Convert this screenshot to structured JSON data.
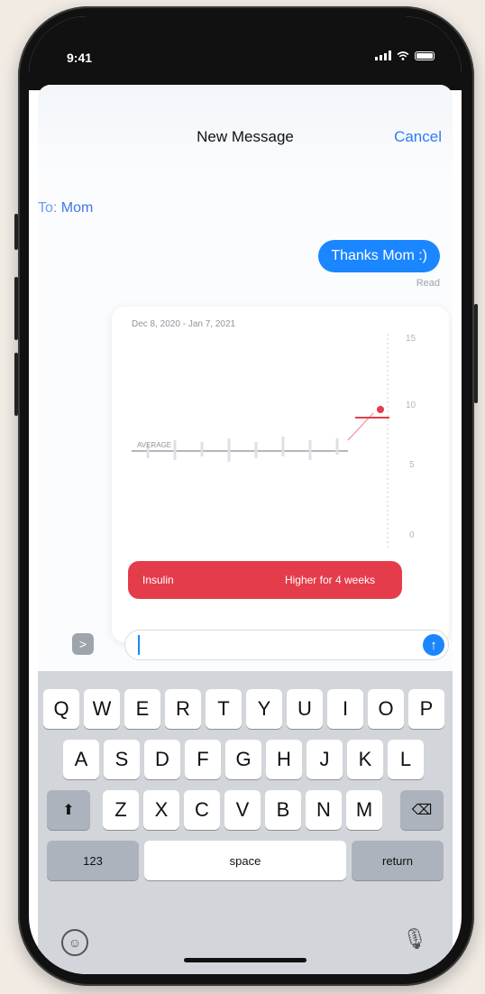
{
  "status": {
    "time": "9:41"
  },
  "nav": {
    "title": "New Message",
    "cancel_label": "Cancel"
  },
  "to": {
    "label": "To:",
    "recipient": "Mom"
  },
  "message": {
    "text": "Thanks Mom :)",
    "receipt": "Read"
  },
  "card": {
    "date_range": "Dec 8, 2020 - Jan 7, 2021",
    "baseline_label": "AVERAGE",
    "banner_left": "Insulin",
    "banner_right": "Higher for 4 weeks",
    "y_ticks": [
      "15",
      "10",
      "5",
      "0"
    ],
    "accent_color": "#e53c4b"
  },
  "compose": {
    "apps_glyph": ">",
    "send_glyph": "↑"
  },
  "keyboard": {
    "row1": [
      "Q",
      "W",
      "E",
      "R",
      "T",
      "Y",
      "U",
      "I",
      "O",
      "P"
    ],
    "row2": [
      "A",
      "S",
      "D",
      "F",
      "G",
      "H",
      "J",
      "K",
      "L"
    ],
    "row3": [
      "Z",
      "X",
      "C",
      "V",
      "B",
      "N",
      "M"
    ],
    "shift_glyph": "⬆",
    "delete_glyph": "⌫",
    "numbers_label": "123",
    "space_label": "space",
    "return_label": "return",
    "emoji_glyph": "☺",
    "mic_glyph": "🎙"
  },
  "colors": {
    "ios_blue": "#1a86ff",
    "alert_red": "#e53c4b"
  }
}
